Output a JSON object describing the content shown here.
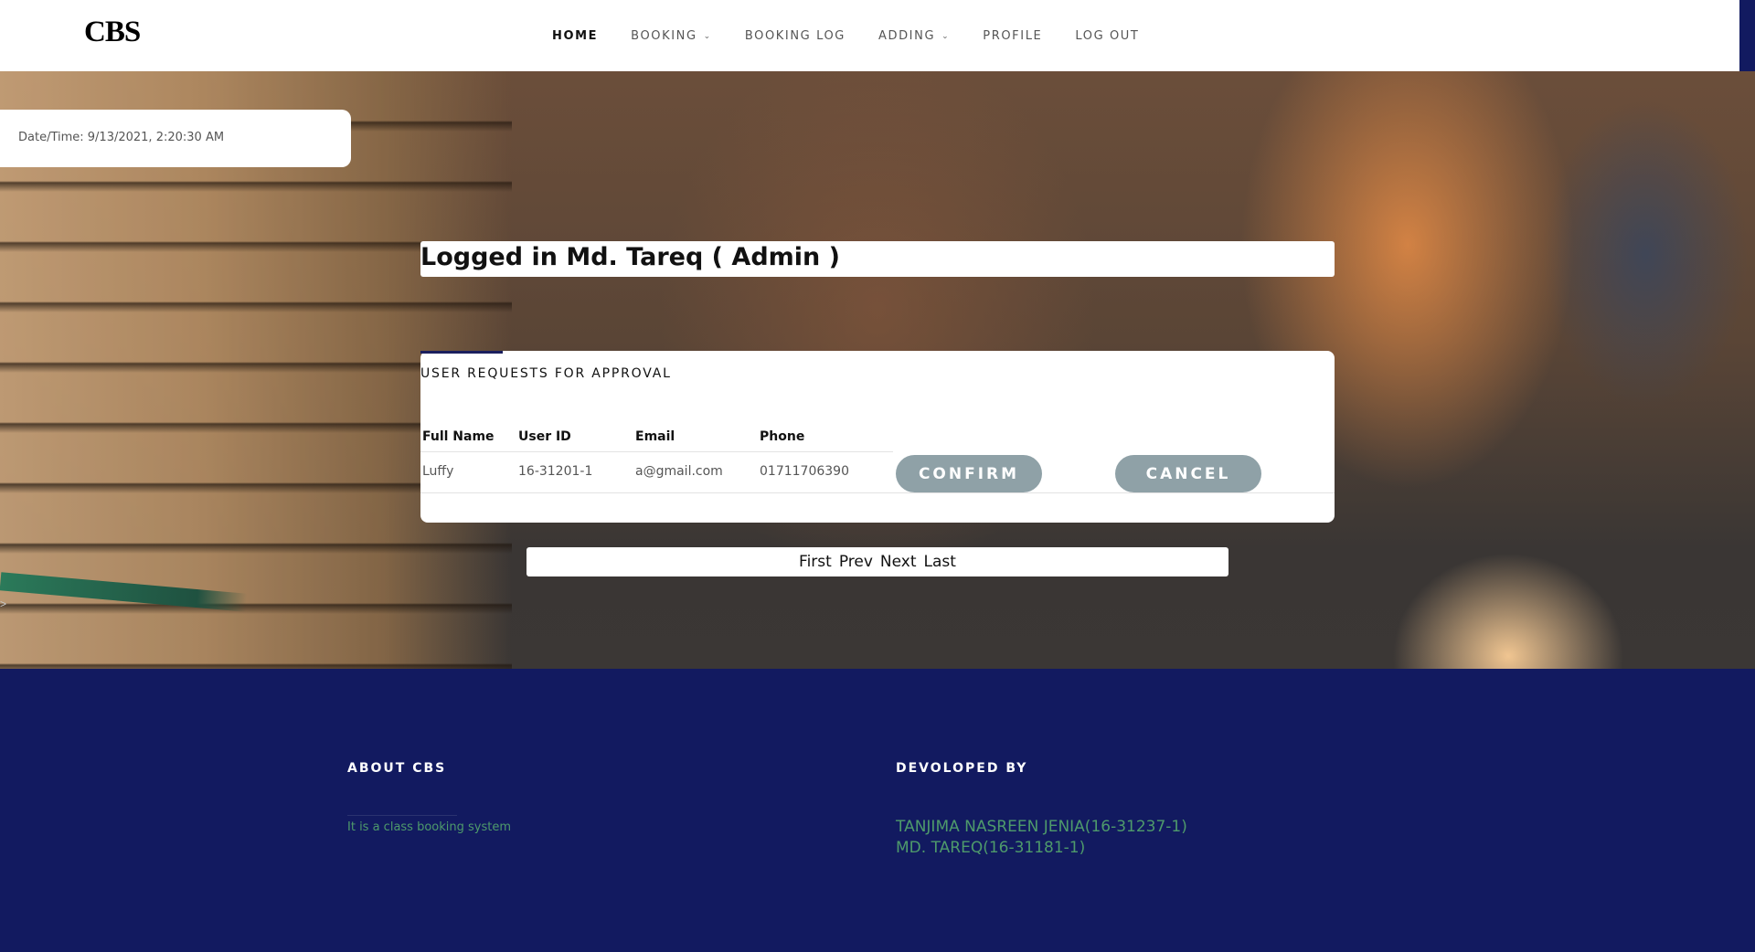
{
  "brand": {
    "name": "CBS"
  },
  "nav": {
    "items": [
      {
        "label": "HOME"
      },
      {
        "label": "BOOKING"
      },
      {
        "label": "BOOKING LOG"
      },
      {
        "label": "ADDING"
      },
      {
        "label": "PROFILE"
      },
      {
        "label": "LOG OUT"
      }
    ],
    "dropdown_glyph": "⌄"
  },
  "datetime": {
    "text": "Date/Time: 9/13/2021, 2:20:30 AM"
  },
  "session": {
    "logged_text": "Logged in Md. Tareq ( Admin )"
  },
  "requests": {
    "title": "USER REQUESTS FOR APPROVAL",
    "columns": [
      "Full Name",
      "User ID",
      "Email",
      "Phone"
    ],
    "rows": [
      {
        "full_name": "Luffy",
        "user_id": "16-31201-1",
        "email": "a@gmail.com",
        "phone": "01711706390",
        "confirm_label": "CONFIRM",
        "cancel_label": "CANCEL"
      }
    ]
  },
  "pager": {
    "first": "First",
    "prev": "Prev",
    "next": "Next",
    "last": "Last"
  },
  "side_caret": ">",
  "footer": {
    "about_heading": "ABOUT CBS",
    "about_text": "It is a class booking system",
    "dev_heading": "DEVOLOPED BY",
    "developers": [
      "TANJIMA NASREEN JENIA(16-31237-1)",
      "MD. TAREQ(16-31181-1)"
    ]
  },
  "colors": {
    "footer_bg": "#121a60",
    "accent_green": "#4e9a6b",
    "button_gray": "#8fa1a7"
  }
}
